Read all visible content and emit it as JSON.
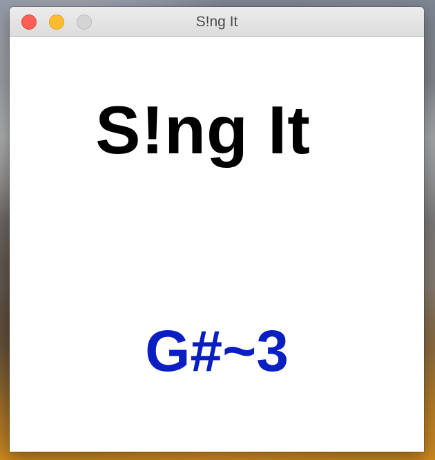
{
  "window": {
    "title": "S!ng It"
  },
  "app": {
    "heading": "S!ng It",
    "detected_note": "G#~3"
  },
  "colors": {
    "note_text": "#0a1fc2",
    "heading_text": "#000000",
    "close_button": "#fd5f57",
    "minimize_button": "#febc2e",
    "zoom_button_inactive": "#d4d4d4"
  },
  "icons": {
    "close": "close-icon",
    "minimize": "minimize-icon",
    "zoom": "zoom-icon"
  }
}
